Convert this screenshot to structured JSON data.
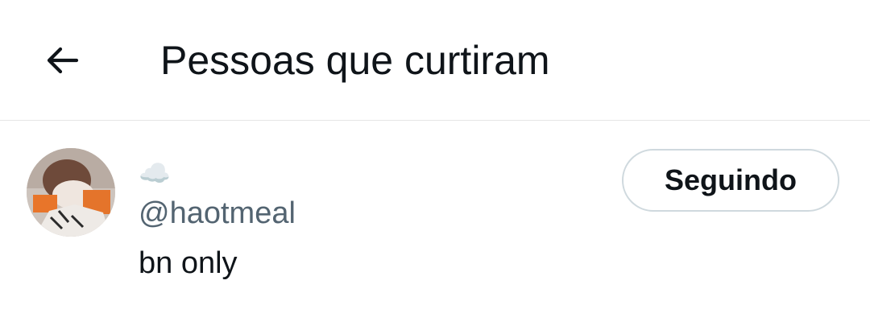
{
  "header": {
    "back_icon": "arrow-left-icon",
    "title": "Pessoas que curtiram"
  },
  "user": {
    "avatar_icon": "user-avatar",
    "display_name": "☁️",
    "handle": "@haotmeal",
    "bio": "bn only",
    "follow_label": "Seguindo"
  },
  "colors": {
    "text_primary": "#0f1419",
    "text_secondary": "#536471",
    "divider": "#e6e6e6",
    "button_border": "#cfd9de"
  }
}
